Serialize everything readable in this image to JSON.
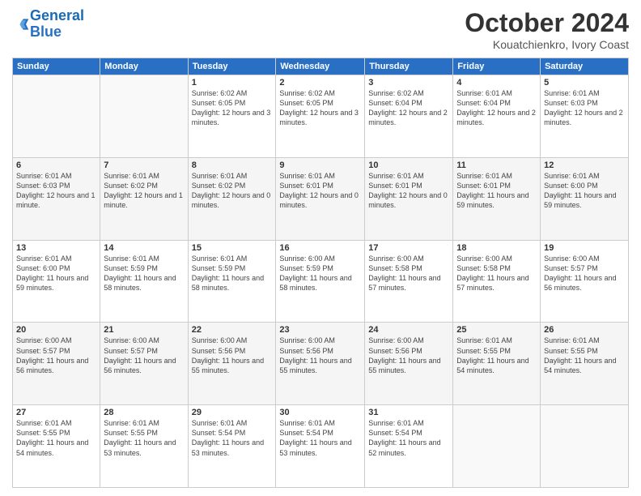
{
  "header": {
    "logo_line1": "General",
    "logo_line2": "Blue",
    "month_title": "October 2024",
    "location": "Kouatchienkro, Ivory Coast"
  },
  "days_of_week": [
    "Sunday",
    "Monday",
    "Tuesday",
    "Wednesday",
    "Thursday",
    "Friday",
    "Saturday"
  ],
  "weeks": [
    [
      {
        "num": "",
        "info": ""
      },
      {
        "num": "",
        "info": ""
      },
      {
        "num": "1",
        "info": "Sunrise: 6:02 AM\nSunset: 6:05 PM\nDaylight: 12 hours and 3 minutes."
      },
      {
        "num": "2",
        "info": "Sunrise: 6:02 AM\nSunset: 6:05 PM\nDaylight: 12 hours and 3 minutes."
      },
      {
        "num": "3",
        "info": "Sunrise: 6:02 AM\nSunset: 6:04 PM\nDaylight: 12 hours and 2 minutes."
      },
      {
        "num": "4",
        "info": "Sunrise: 6:01 AM\nSunset: 6:04 PM\nDaylight: 12 hours and 2 minutes."
      },
      {
        "num": "5",
        "info": "Sunrise: 6:01 AM\nSunset: 6:03 PM\nDaylight: 12 hours and 2 minutes."
      }
    ],
    [
      {
        "num": "6",
        "info": "Sunrise: 6:01 AM\nSunset: 6:03 PM\nDaylight: 12 hours and 1 minute."
      },
      {
        "num": "7",
        "info": "Sunrise: 6:01 AM\nSunset: 6:02 PM\nDaylight: 12 hours and 1 minute."
      },
      {
        "num": "8",
        "info": "Sunrise: 6:01 AM\nSunset: 6:02 PM\nDaylight: 12 hours and 0 minutes."
      },
      {
        "num": "9",
        "info": "Sunrise: 6:01 AM\nSunset: 6:01 PM\nDaylight: 12 hours and 0 minutes."
      },
      {
        "num": "10",
        "info": "Sunrise: 6:01 AM\nSunset: 6:01 PM\nDaylight: 12 hours and 0 minutes."
      },
      {
        "num": "11",
        "info": "Sunrise: 6:01 AM\nSunset: 6:01 PM\nDaylight: 11 hours and 59 minutes."
      },
      {
        "num": "12",
        "info": "Sunrise: 6:01 AM\nSunset: 6:00 PM\nDaylight: 11 hours and 59 minutes."
      }
    ],
    [
      {
        "num": "13",
        "info": "Sunrise: 6:01 AM\nSunset: 6:00 PM\nDaylight: 11 hours and 59 minutes."
      },
      {
        "num": "14",
        "info": "Sunrise: 6:01 AM\nSunset: 5:59 PM\nDaylight: 11 hours and 58 minutes."
      },
      {
        "num": "15",
        "info": "Sunrise: 6:01 AM\nSunset: 5:59 PM\nDaylight: 11 hours and 58 minutes."
      },
      {
        "num": "16",
        "info": "Sunrise: 6:00 AM\nSunset: 5:59 PM\nDaylight: 11 hours and 58 minutes."
      },
      {
        "num": "17",
        "info": "Sunrise: 6:00 AM\nSunset: 5:58 PM\nDaylight: 11 hours and 57 minutes."
      },
      {
        "num": "18",
        "info": "Sunrise: 6:00 AM\nSunset: 5:58 PM\nDaylight: 11 hours and 57 minutes."
      },
      {
        "num": "19",
        "info": "Sunrise: 6:00 AM\nSunset: 5:57 PM\nDaylight: 11 hours and 56 minutes."
      }
    ],
    [
      {
        "num": "20",
        "info": "Sunrise: 6:00 AM\nSunset: 5:57 PM\nDaylight: 11 hours and 56 minutes."
      },
      {
        "num": "21",
        "info": "Sunrise: 6:00 AM\nSunset: 5:57 PM\nDaylight: 11 hours and 56 minutes."
      },
      {
        "num": "22",
        "info": "Sunrise: 6:00 AM\nSunset: 5:56 PM\nDaylight: 11 hours and 55 minutes."
      },
      {
        "num": "23",
        "info": "Sunrise: 6:00 AM\nSunset: 5:56 PM\nDaylight: 11 hours and 55 minutes."
      },
      {
        "num": "24",
        "info": "Sunrise: 6:00 AM\nSunset: 5:56 PM\nDaylight: 11 hours and 55 minutes."
      },
      {
        "num": "25",
        "info": "Sunrise: 6:01 AM\nSunset: 5:55 PM\nDaylight: 11 hours and 54 minutes."
      },
      {
        "num": "26",
        "info": "Sunrise: 6:01 AM\nSunset: 5:55 PM\nDaylight: 11 hours and 54 minutes."
      }
    ],
    [
      {
        "num": "27",
        "info": "Sunrise: 6:01 AM\nSunset: 5:55 PM\nDaylight: 11 hours and 54 minutes."
      },
      {
        "num": "28",
        "info": "Sunrise: 6:01 AM\nSunset: 5:55 PM\nDaylight: 11 hours and 53 minutes."
      },
      {
        "num": "29",
        "info": "Sunrise: 6:01 AM\nSunset: 5:54 PM\nDaylight: 11 hours and 53 minutes."
      },
      {
        "num": "30",
        "info": "Sunrise: 6:01 AM\nSunset: 5:54 PM\nDaylight: 11 hours and 53 minutes."
      },
      {
        "num": "31",
        "info": "Sunrise: 6:01 AM\nSunset: 5:54 PM\nDaylight: 11 hours and 52 minutes."
      },
      {
        "num": "",
        "info": ""
      },
      {
        "num": "",
        "info": ""
      }
    ]
  ]
}
